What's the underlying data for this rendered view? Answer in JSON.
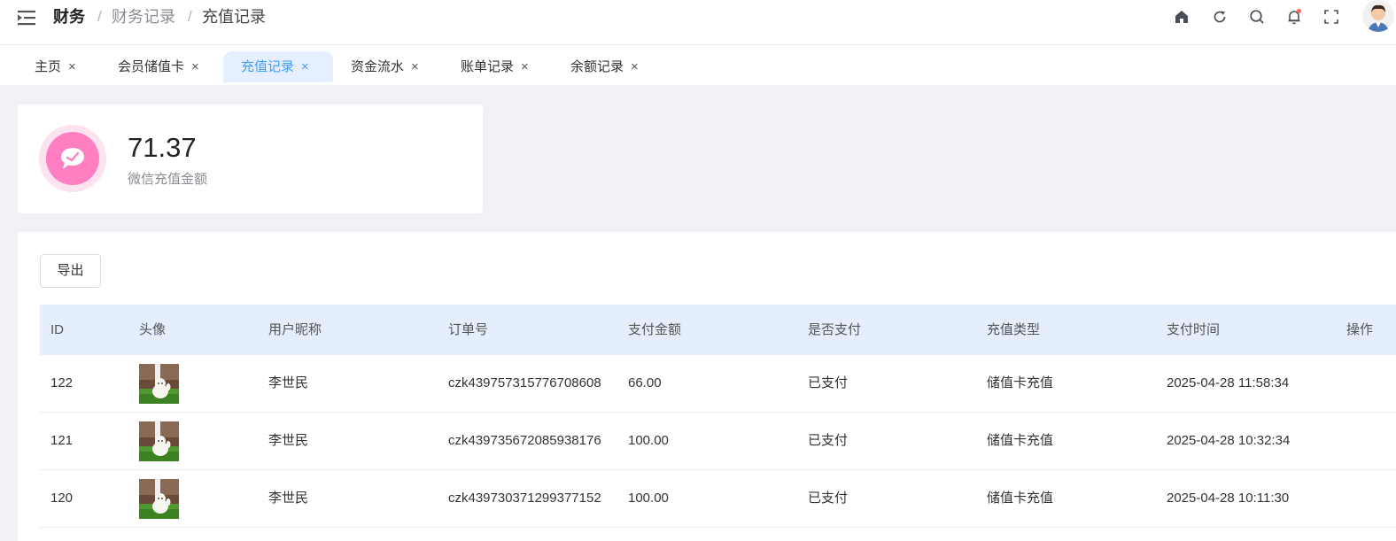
{
  "breadcrumb": {
    "root": "财务",
    "separator": "/",
    "level2": "财务记录",
    "current": "充值记录"
  },
  "header_icons": [
    "home-icon",
    "refresh-icon",
    "search-icon",
    "bell-icon",
    "fullscreen-icon"
  ],
  "colors": {
    "accent": "#409eff",
    "wechat_pink": "#ff7fc2",
    "notification_dot": "#f56c6c",
    "table_header_bg": "#e5eefc"
  },
  "tabs": [
    {
      "label": "主页",
      "active": false
    },
    {
      "label": "会员储值卡",
      "active": false
    },
    {
      "label": "充值记录",
      "active": true
    },
    {
      "label": "资金流水",
      "active": false
    },
    {
      "label": "账单记录",
      "active": false
    },
    {
      "label": "余额记录",
      "active": false
    }
  ],
  "tab_close": "×",
  "stat": {
    "value": "71.37",
    "label": "微信充值金额"
  },
  "toolbar": {
    "export_label": "导出"
  },
  "table": {
    "columns": [
      "ID",
      "头像",
      "用户昵称",
      "订单号",
      "支付金额",
      "是否支付",
      "充值类型",
      "支付时间",
      "操作"
    ],
    "rows": [
      {
        "id": "122",
        "nickname": "李世民",
        "order_no": "czk439757315776708608",
        "amount": "66.00",
        "paid": "已支付",
        "type": "储值卡充值",
        "time": "2025-04-28 11:58:34"
      },
      {
        "id": "121",
        "nickname": "李世民",
        "order_no": "czk439735672085938176",
        "amount": "100.00",
        "paid": "已支付",
        "type": "储值卡充值",
        "time": "2025-04-28 10:32:34"
      },
      {
        "id": "120",
        "nickname": "李世民",
        "order_no": "czk439730371299377152",
        "amount": "100.00",
        "paid": "已支付",
        "type": "储值卡充值",
        "time": "2025-04-28 10:11:30"
      }
    ]
  }
}
